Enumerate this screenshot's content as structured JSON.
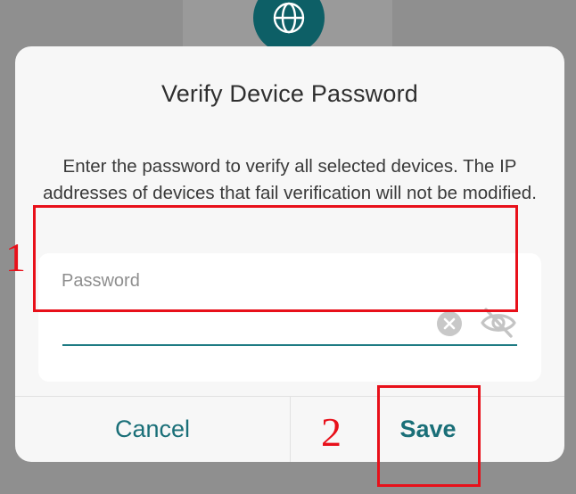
{
  "header": {
    "icon": "globe-icon",
    "icon_color": "#0d5f66"
  },
  "dialog": {
    "title": "Verify Device Password",
    "description": "Enter the password to verify all selected devices. The IP addresses of devices that fail verification will not be modified.",
    "password_field": {
      "label": "Password",
      "value": "",
      "clear_icon": "clear-circle-icon",
      "visibility_icon": "eye-off-icon",
      "underline_color": "#1e7b83"
    },
    "buttons": {
      "cancel_label": "Cancel",
      "save_label": "Save",
      "accent_color": "#1a6f78"
    }
  },
  "annotations": {
    "marker_1": "1",
    "marker_2": "2",
    "color": "#e8101a"
  }
}
